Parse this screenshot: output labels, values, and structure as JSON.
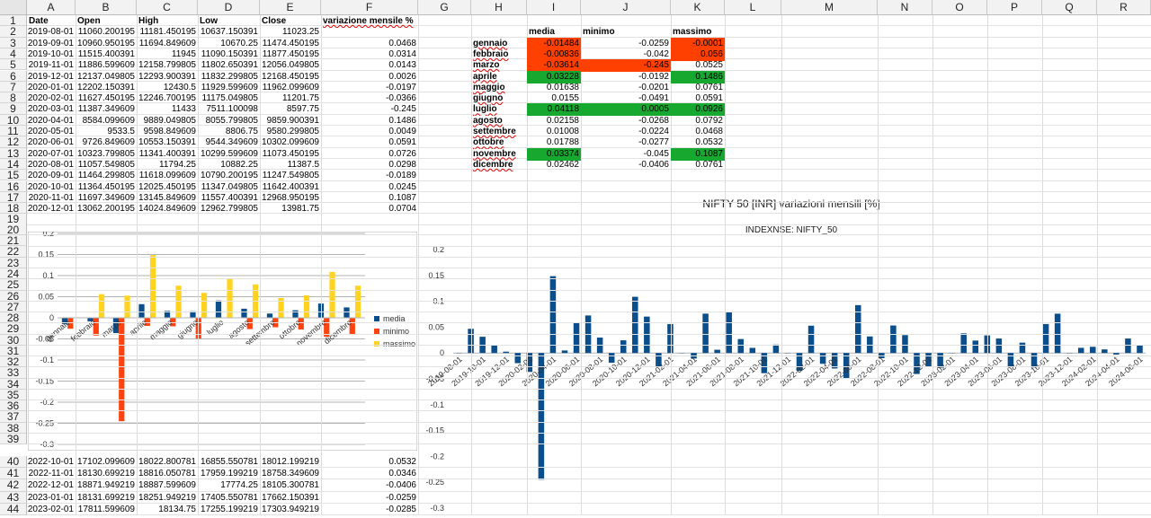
{
  "columns": [
    "A",
    "B",
    "C",
    "D",
    "E",
    "F",
    "G",
    "H",
    "I",
    "J",
    "K",
    "L",
    "M",
    "N",
    "O",
    "P",
    "Q",
    "R"
  ],
  "rows_top": [
    "1",
    "2",
    "3",
    "4",
    "5",
    "6",
    "7",
    "8",
    "9",
    "10",
    "11",
    "12",
    "13",
    "14",
    "15",
    "16",
    "17",
    "18",
    "19"
  ],
  "rows_mid": [
    "20",
    "21",
    "22",
    "23",
    "24",
    "25",
    "26",
    "27",
    "28",
    "29",
    "30",
    "31",
    "32",
    "33",
    "34",
    "35",
    "36",
    "37",
    "38",
    "39"
  ],
  "rows_bot": [
    "40",
    "41",
    "42",
    "43",
    "44"
  ],
  "data_header": [
    "Date",
    "Open",
    "High",
    "Low",
    "Close",
    "variazione mensile %"
  ],
  "data_rows": [
    [
      "2019-08-01",
      "11060.200195",
      "11181.450195",
      "10637.150391",
      "11023.25",
      ""
    ],
    [
      "2019-09-01",
      "10960.950195",
      "11694.849609",
      "10670.25",
      "11474.450195",
      "0.0468"
    ],
    [
      "2019-10-01",
      "11515.400391",
      "11945",
      "11090.150391",
      "11877.450195",
      "0.0314"
    ],
    [
      "2019-11-01",
      "11886.599609",
      "12158.799805",
      "11802.650391",
      "12056.049805",
      "0.0143"
    ],
    [
      "2019-12-01",
      "12137.049805",
      "12293.900391",
      "11832.299805",
      "12168.450195",
      "0.0026"
    ],
    [
      "2020-01-01",
      "12202.150391",
      "12430.5",
      "11929.599609",
      "11962.099609",
      "-0.0197"
    ],
    [
      "2020-02-01",
      "11627.450195",
      "12246.700195",
      "11175.049805",
      "11201.75",
      "-0.0366"
    ],
    [
      "2020-03-01",
      "11387.349609",
      "11433",
      "7511.100098",
      "8597.75",
      "-0.245"
    ],
    [
      "2020-04-01",
      "8584.099609",
      "9889.049805",
      "8055.799805",
      "9859.900391",
      "0.1486"
    ],
    [
      "2020-05-01",
      "9533.5",
      "9598.849609",
      "8806.75",
      "9580.299805",
      "0.0049"
    ],
    [
      "2020-06-01",
      "9726.849609",
      "10553.150391",
      "9544.349609",
      "10302.099609",
      "0.0591"
    ],
    [
      "2020-07-01",
      "10323.799805",
      "11341.400391",
      "10299.599609",
      "11073.450195",
      "0.0726"
    ],
    [
      "2020-08-01",
      "11057.549805",
      "11794.25",
      "10882.25",
      "11387.5",
      "0.0298"
    ],
    [
      "2020-09-01",
      "11464.299805",
      "11618.099609",
      "10790.200195",
      "11247.549805",
      "-0.0189"
    ],
    [
      "2020-10-01",
      "11364.450195",
      "12025.450195",
      "11347.049805",
      "11642.400391",
      "0.0245"
    ],
    [
      "2020-11-01",
      "11697.349609",
      "13145.849609",
      "11557.400391",
      "12968.950195",
      "0.1087"
    ],
    [
      "2020-12-01",
      "13062.200195",
      "14024.849609",
      "12962.799805",
      "13981.75",
      "0.0704"
    ]
  ],
  "bottom_rows": [
    [
      "2022-10-01",
      "17102.099609",
      "18022.800781",
      "16855.550781",
      "18012.199219",
      "0.0532"
    ],
    [
      "2022-11-01",
      "18130.699219",
      "18816.050781",
      "17959.199219",
      "18758.349609",
      "0.0346"
    ],
    [
      "2022-12-01",
      "18871.949219",
      "18887.599609",
      "17774.25",
      "18105.300781",
      "-0.0406"
    ],
    [
      "2023-01-01",
      "18131.699219",
      "18251.949219",
      "17405.550781",
      "17662.150391",
      "-0.0259"
    ],
    [
      "2023-02-01",
      "17811.599609",
      "18134.75",
      "17255.199219",
      "17303.949219",
      "-0.0285"
    ]
  ],
  "stats_header": [
    "media",
    "minimo",
    "massimo"
  ],
  "stats_rows": [
    {
      "month": "gennaio",
      "media": "-0.01484",
      "minimo": "-0.0259",
      "massimo": "-0.0001"
    },
    {
      "month": "febbraio",
      "media": "-0.00836",
      "minimo": "-0.042",
      "massimo": "0.056"
    },
    {
      "month": "marzo",
      "media": "-0.03614",
      "minimo": "-0.245",
      "massimo": "0.0525"
    },
    {
      "month": "aprile",
      "media": "0.03228",
      "minimo": "-0.0192",
      "massimo": "0.1486"
    },
    {
      "month": "maggio",
      "media": "0.01638",
      "minimo": "-0.0201",
      "massimo": "0.0761"
    },
    {
      "month": "giugno",
      "media": "0.0155",
      "minimo": "-0.0491",
      "massimo": "0.0591"
    },
    {
      "month": "luglio",
      "media": "0.04118",
      "minimo": "0.0005",
      "massimo": "0.0926"
    },
    {
      "month": "agosto",
      "media": "0.02158",
      "minimo": "-0.0268",
      "massimo": "0.0792"
    },
    {
      "month": "settembre",
      "media": "0.01008",
      "minimo": "-0.0224",
      "massimo": "0.0468"
    },
    {
      "month": "ottobre",
      "media": "0.01788",
      "minimo": "-0.0277",
      "massimo": "0.0532"
    },
    {
      "month": "novembre",
      "media": "0.03374",
      "minimo": "-0.045",
      "massimo": "0.1087"
    },
    {
      "month": "dicembre",
      "media": "0.02462",
      "minimo": "-0.0406",
      "massimo": "0.0761"
    }
  ],
  "colors": {
    "red": "#ff4000",
    "green": "#17a830",
    "media": "#0b4e8c",
    "minimo": "#ff420e",
    "massimo": "#ffd320"
  },
  "chart_data": [
    {
      "type": "bar",
      "categories": [
        "gennaio",
        "febbraio",
        "marzo",
        "aprile",
        "maggio",
        "giugno",
        "luglio",
        "agosto",
        "settembre",
        "ottobre",
        "novembre",
        "dicembre"
      ],
      "series": [
        {
          "name": "media",
          "values": [
            -0.01484,
            -0.00836,
            -0.03614,
            0.03228,
            0.01638,
            0.0155,
            0.04118,
            0.02158,
            0.01008,
            0.01788,
            0.03374,
            0.02462
          ]
        },
        {
          "name": "minimo",
          "values": [
            -0.0259,
            -0.042,
            -0.245,
            -0.0192,
            -0.0201,
            -0.0491,
            0.0005,
            -0.0268,
            -0.0224,
            -0.0277,
            -0.045,
            -0.0406
          ]
        },
        {
          "name": "massimo",
          "values": [
            -0.0001,
            0.056,
            0.0525,
            0.1486,
            0.0761,
            0.0591,
            0.0926,
            0.0792,
            0.0468,
            0.0532,
            0.1087,
            0.0761
          ]
        }
      ],
      "ylim": [
        -0.3,
        0.2
      ],
      "yticks": [
        "0.2",
        "0.15",
        "0.1",
        "0.05",
        "0",
        "-0.05",
        "-0.1",
        "-0.15",
        "-0.2",
        "-0.25",
        "-0.3"
      ],
      "legend": "right"
    },
    {
      "type": "bar",
      "title": "NIFTY 50 [INR] variazioni mensili [%]",
      "subtitle": "INDEXNSE: NIFTY_50",
      "ylim": [
        -0.3,
        0.2
      ],
      "yticks": [
        "0.2",
        "0.15",
        "0.1",
        "0.05",
        "0",
        "-0.05",
        "-0.1",
        "-0.15",
        "-0.2",
        "-0.25",
        "-0.3"
      ],
      "xtick_labels": [
        "2019-08-01",
        "2019-10-01",
        "2019-12-01",
        "2020-02-01",
        "2020-04-01",
        "2020-06-01",
        "2020-08-01",
        "2020-10-01",
        "2020-12-01",
        "2021-02-01",
        "2021-04-01",
        "2021-06-01",
        "2021-08-01",
        "2021-10-01",
        "2021-12-01",
        "2022-02-01",
        "2022-04-01",
        "2022-06-01",
        "2022-08-01",
        "2022-10-01",
        "2022-12-01",
        "2023-02-01",
        "2023-04-01",
        "2023-06-01",
        "2023-08-01",
        "2023-10-01",
        "2023-12-01",
        "2024-02-01",
        "2024-04-01",
        "2024-06-01"
      ],
      "values": [
        0,
        0.0468,
        0.0314,
        0.0143,
        0.0026,
        -0.0197,
        -0.0366,
        -0.245,
        0.1486,
        0.0049,
        0.0591,
        0.0726,
        0.0298,
        -0.0189,
        0.0245,
        0.1087,
        0.0704,
        -0.0259,
        0.056,
        0.0001,
        -0.0107,
        0.0761,
        0.0063,
        0.0792,
        0.027,
        0.0099,
        -0.039,
        0.0164,
        0.0001,
        -0.0347,
        0.0528,
        -0.0209,
        -0.03,
        -0.0491,
        0.0926,
        0.032,
        -0.01,
        0.0532,
        0.0346,
        -0.0406,
        -0.0259,
        -0.0285,
        0.0001,
        0.038,
        0.024,
        0.034,
        0.028,
        -0.027,
        0.02,
        -0.028,
        0.056,
        0.076,
        0.0002,
        0.01,
        0.012,
        0.007,
        -0.003,
        0.028,
        0.015
      ]
    }
  ]
}
